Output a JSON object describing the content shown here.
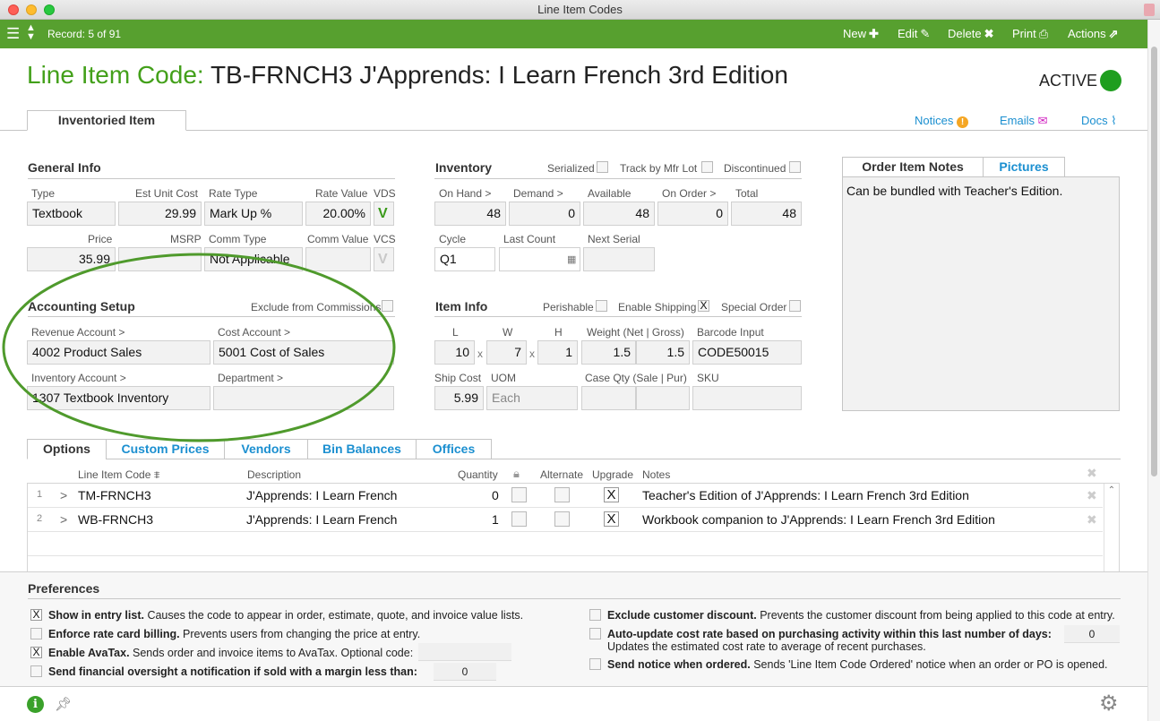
{
  "window": {
    "title": "Line Item Codes"
  },
  "toolbar": {
    "record": "Record: 5 of 91",
    "new": "New",
    "edit": "Edit",
    "delete": "Delete",
    "print": "Print",
    "actions": "Actions"
  },
  "header": {
    "prefix": "Line Item Code:",
    "title": "TB-FRNCH3 J'Apprends: I Learn French 3rd Edition",
    "status": "ACTIVE"
  },
  "top_tabs": {
    "active": "Inventoried Item",
    "notices": "Notices",
    "emails": "Emails",
    "docs": "Docs"
  },
  "general": {
    "title": "General Info",
    "type_label": "Type",
    "type": "Textbook",
    "est_cost_label": "Est Unit Cost",
    "est_cost": "29.99",
    "rate_type_label": "Rate Type",
    "rate_type": "Mark Up %",
    "rate_value_label": "Rate Value",
    "rate_value": "20.00%",
    "vds_label": "VDS",
    "vds": "V",
    "price_label": "Price",
    "price": "35.99",
    "msrp_label": "MSRP",
    "msrp": "",
    "comm_type_label": "Comm Type",
    "comm_type": "Not Applicable",
    "comm_value_label": "Comm Value",
    "comm_value": "",
    "vcs_label": "VCS",
    "vcs": "V"
  },
  "accounting": {
    "title": "Accounting Setup",
    "exclude_label": "Exclude from Commissions",
    "revenue_label": "Revenue Account >",
    "revenue": "4002 Product Sales",
    "cost_label": "Cost Account >",
    "cost": "5001 Cost of Sales",
    "inventory_label": "Inventory Account >",
    "inventory": "1307 Textbook Inventory",
    "department_label": "Department >",
    "department": ""
  },
  "inventory": {
    "title": "Inventory",
    "serialized": "Serialized",
    "track_mfr": "Track by Mfr Lot",
    "discontinued": "Discontinued",
    "on_hand_label": "On Hand >",
    "on_hand": "48",
    "demand_label": "Demand >",
    "demand": "0",
    "available_label": "Available",
    "available": "48",
    "on_order_label": "On Order >",
    "on_order": "0",
    "total_label": "Total",
    "total": "48",
    "cycle_label": "Cycle",
    "cycle": "Q1",
    "last_count_label": "Last Count",
    "last_count": "",
    "next_serial_label": "Next Serial",
    "next_serial": ""
  },
  "iteminfo": {
    "title": "Item Info",
    "perishable": "Perishable",
    "enable_shipping": "Enable Shipping",
    "special_order": "Special Order",
    "l_label": "L",
    "l": "10",
    "w_label": "W",
    "w": "7",
    "h_label": "H",
    "h": "1",
    "x": "x",
    "weight_label": "Weight (Net | Gross)",
    "weight_net": "1.5",
    "weight_gross": "1.5",
    "barcode_label": "Barcode Input",
    "barcode": "CODE50015",
    "ship_cost_label": "Ship Cost",
    "ship_cost": "5.99",
    "uom_label": "UOM",
    "uom": "Each",
    "case_qty_label": "Case Qty (Sale | Pur)",
    "sku_label": "SKU"
  },
  "notes_panel": {
    "tab_notes": "Order Item Notes",
    "tab_pictures": "Pictures",
    "text": "Can be bundled with Teacher's Edition."
  },
  "lower_tabs": [
    "Options",
    "Custom Prices",
    "Vendors",
    "Bin Balances",
    "Offices"
  ],
  "grid": {
    "headers": {
      "code": "Line Item Code",
      "description": "Description",
      "quantity": "Quantity",
      "alternate": "Alternate",
      "upgrade": "Upgrade",
      "notes": "Notes"
    },
    "rows": [
      {
        "num": "1",
        "code": "TM-FRNCH3",
        "description": "J'Apprends: I Learn French",
        "quantity": "0",
        "upgrade": "X",
        "notes": "Teacher's Edition of J'Apprends: I Learn French 3rd Edition"
      },
      {
        "num": "2",
        "code": "WB-FRNCH3",
        "description": "J'Apprends: I Learn French",
        "quantity": "1",
        "upgrade": "X",
        "notes": "Workbook companion to J'Apprends: I Learn French 3rd Edition"
      }
    ]
  },
  "preferences": {
    "title": "Preferences",
    "p1_b": "Show in entry list.",
    "p1": " Causes the code to appear in order, estimate, quote, and invoice value lists.",
    "p2_b": "Enforce rate card billing.",
    "p2": " Prevents users from changing the price at entry.",
    "p3_b": "Enable AvaTax.",
    "p3": " Sends order and invoice items to AvaTax. Optional code:",
    "p4_b": "Send financial oversight a notification if sold with a margin less than:",
    "p4_val": "0",
    "p5_b": "Exclude customer discount.",
    "p5": " Prevents the customer discount from being applied to this code at entry.",
    "p6_b": "Auto-update cost rate based on purchasing activity within this last number of days:",
    "p6_sub": "Updates the estimated cost rate to average of recent purchases.",
    "p6_val": "0",
    "p7_b": "Send notice when ordered.",
    "p7": " Sends 'Line Item Code Ordered' notice when an order or PO is opened.",
    "checked": "X"
  },
  "colors": {
    "brand_green": "#57a02f",
    "title_green": "#43a01a",
    "link_blue": "#1b8fd0",
    "annotation_green": "#4f9a2c"
  }
}
